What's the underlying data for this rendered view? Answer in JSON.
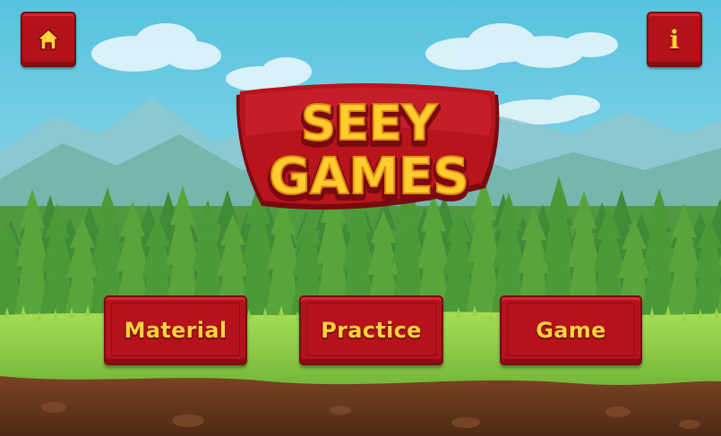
{
  "title": {
    "line1": "SEEY",
    "line2": "GAMES"
  },
  "buttons": {
    "home": {
      "icon": "home-icon"
    },
    "info": {
      "icon": "info-icon",
      "glyph": "i"
    },
    "material": {
      "label": "Material"
    },
    "practice": {
      "label": "Practice"
    },
    "game": {
      "label": "Game"
    }
  },
  "colors": {
    "button_red": "#b5121b",
    "button_text": "#ffd23a",
    "sky_top": "#5fc6df",
    "grass": "#8fd14a",
    "soil": "#6b3a1f"
  }
}
